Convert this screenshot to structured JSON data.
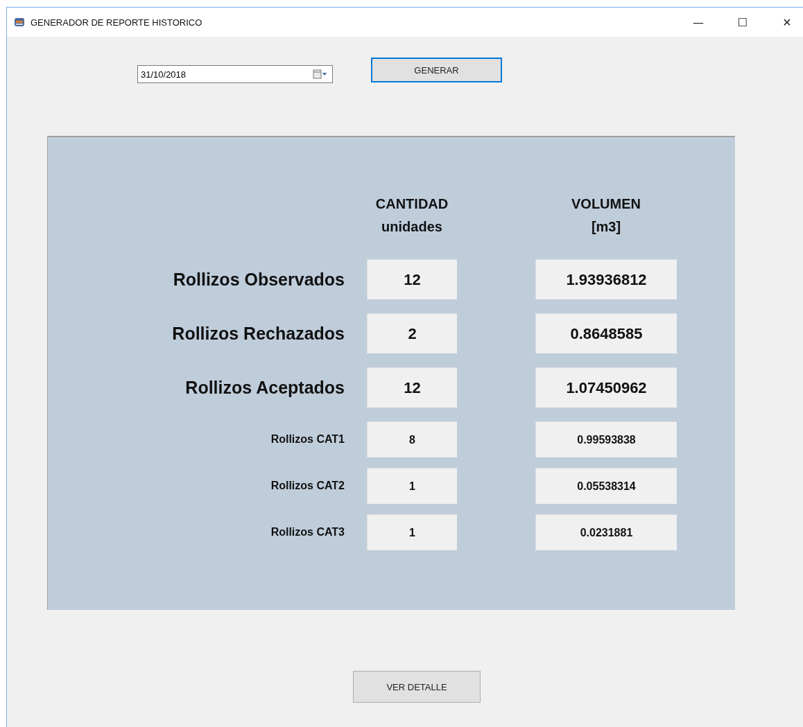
{
  "window": {
    "title": "GENERADOR DE REPORTE HISTORICO",
    "controls": [
      "—",
      "☐",
      "✕"
    ]
  },
  "date_field": {
    "value": "31/10/2018"
  },
  "generate_button": {
    "label": "GENERAR"
  },
  "report": {
    "headers": [
      {
        "line1": "CANTIDAD",
        "line2": "unidades"
      },
      {
        "line1": "VOLUMEN",
        "line2": "[m3]"
      }
    ],
    "rows": [
      {
        "kind": "major",
        "label": "Rollizos Observados",
        "quantity": "12",
        "volume": "1.93936812"
      },
      {
        "kind": "major",
        "label": "Rollizos Rechazados",
        "quantity": "2",
        "volume": "0.8648585"
      },
      {
        "kind": "major",
        "label": "Rollizos Aceptados",
        "quantity": "12",
        "volume": "1.07450962"
      },
      {
        "kind": "minor",
        "label": "Rollizos CAT1",
        "quantity": "8",
        "volume": "0.99593838"
      },
      {
        "kind": "minor",
        "label": "Rollizos CAT2",
        "quantity": "1",
        "volume": "0.05538314"
      },
      {
        "kind": "minor",
        "label": "Rollizos CAT3",
        "quantity": "1",
        "volume": "0.0231881"
      }
    ]
  },
  "detail_button": {
    "label": "VER DETALLE"
  }
}
